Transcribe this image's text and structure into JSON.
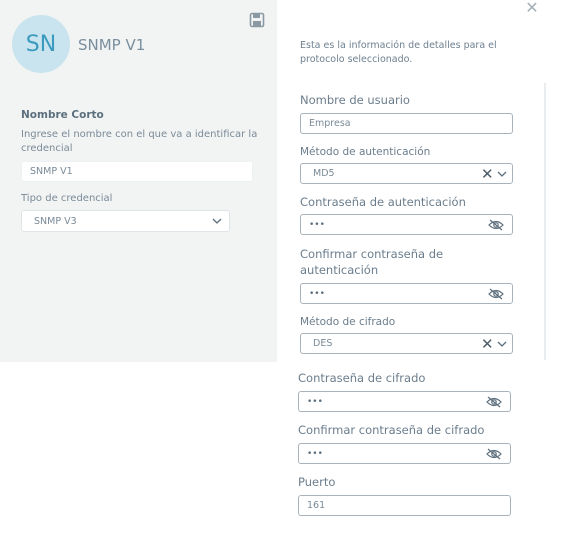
{
  "header": {
    "avatar_initials": "SN",
    "title": "SNMP V1"
  },
  "left": {
    "short_name_label": "Nombre Corto",
    "short_name_help": "Ingrese el nombre con el que va a identificar la credencial",
    "short_name_value": "SNMP V1",
    "credential_type_label": "Tipo de credencial",
    "credential_type_value": "SNMP V3"
  },
  "right": {
    "description": "Esta es la información de detalles para el protocolo seleccionado.",
    "username_label": "Nombre de usuario",
    "username_value": "Empresa",
    "auth_method_label": "Método de autenticación",
    "auth_method_value": "MD5",
    "auth_password_label": "Contraseña de autenticación",
    "auth_password_value": "•••",
    "confirm_auth_password_label": "Confirmar contraseña de autenticación",
    "confirm_auth_password_value": "•••",
    "encryption_method_label": "Método de cifrado",
    "encryption_method_value": "DES",
    "encryption_password_label": "Contraseña de cifrado",
    "encryption_password_value": "•••",
    "confirm_encryption_password_label": "Confirmar contraseña de cifrado",
    "confirm_encryption_password_value": "•••",
    "port_label": "Puerto",
    "port_value": "161"
  },
  "icons": {
    "save": "save-icon",
    "close": "close-icon",
    "clear": "clear-icon",
    "dropdown": "chevron-down-icon",
    "visibility": "eye-off-icon"
  },
  "colors": {
    "avatar_bg": "#c9e4ee",
    "avatar_text": "#3a9bbf",
    "panel_bg": "#f2f4f4"
  }
}
